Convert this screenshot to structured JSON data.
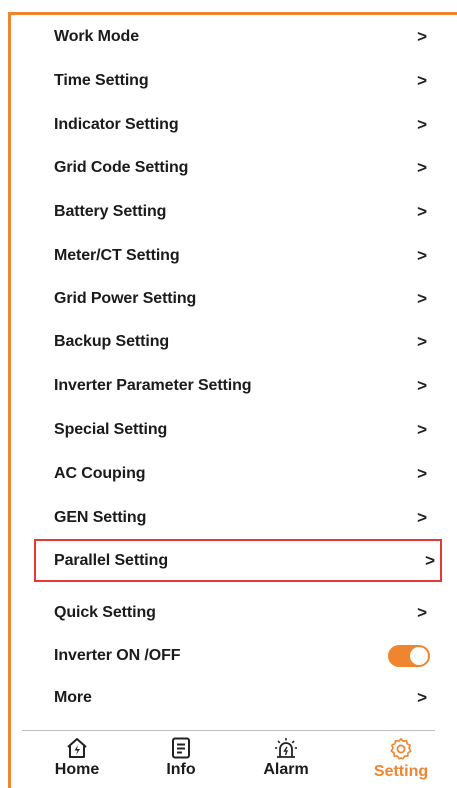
{
  "menu": {
    "items": [
      {
        "label": "Work Mode"
      },
      {
        "label": "Time Setting"
      },
      {
        "label": "Indicator Setting"
      },
      {
        "label": "Grid Code Setting"
      },
      {
        "label": "Battery Setting"
      },
      {
        "label": "Meter/CT Setting"
      },
      {
        "label": "Grid Power Setting"
      },
      {
        "label": "Backup Setting"
      },
      {
        "label": "Inverter Parameter Setting"
      },
      {
        "label": "Special Setting"
      },
      {
        "label": "AC Couping"
      },
      {
        "label": "GEN Setting"
      },
      {
        "label": "Parallel Setting",
        "highlighted": true
      },
      {
        "label": "Quick Setting"
      },
      {
        "label": "Inverter ON /OFF",
        "toggle": true,
        "toggle_on": true
      },
      {
        "label": "More"
      }
    ],
    "chevron": ">"
  },
  "tabs": [
    {
      "label": "Home",
      "icon": "home-icon"
    },
    {
      "label": "Info",
      "icon": "info-icon"
    },
    {
      "label": "Alarm",
      "icon": "alarm-icon"
    },
    {
      "label": "Setting",
      "icon": "gear-icon",
      "active": true
    }
  ],
  "colors": {
    "accent": "#f0852f",
    "highlight": "#e53935"
  }
}
